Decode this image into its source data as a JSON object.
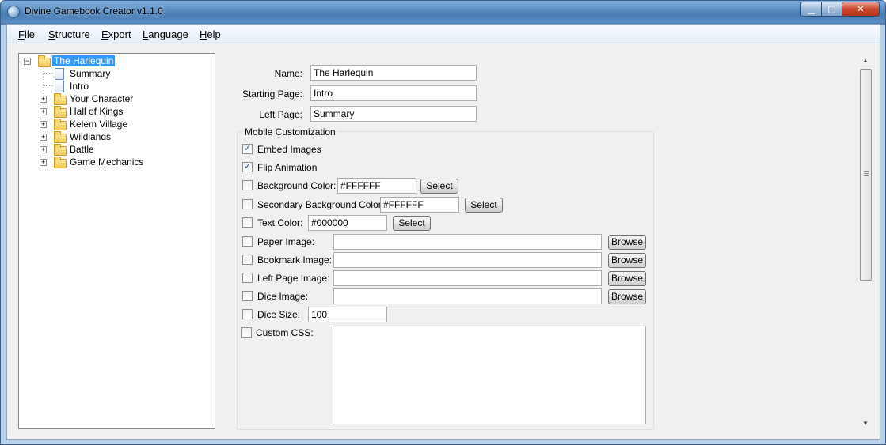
{
  "window": {
    "title": "Divine Gamebook Creator v1.1.0"
  },
  "menu": [
    "File",
    "Structure",
    "Export",
    "Language",
    "Help"
  ],
  "tree": {
    "root": "The Harlequin",
    "pages": [
      "Summary",
      "Intro"
    ],
    "folders": [
      "Your Character",
      "Hall of Kings",
      "Kelem Village",
      "Wildlands",
      "Battle",
      "Game Mechanics"
    ]
  },
  "form": {
    "name_label": "Name:",
    "name_value": "The Harlequin",
    "starting_page_label": "Starting Page:",
    "starting_page_value": "Intro",
    "left_page_label": "Left Page:",
    "left_page_value": "Summary"
  },
  "mobile": {
    "caption": "Mobile Customization",
    "embed_images": {
      "label": "Embed Images",
      "checked": true
    },
    "flip_animation": {
      "label": "Flip Animation",
      "checked": true
    },
    "background_color": {
      "label": "Background Color:",
      "value": "#FFFFFF",
      "button": "Select"
    },
    "secondary_background_color": {
      "label": "Secondary Background Color:",
      "value": "#FFFFFF",
      "button": "Select"
    },
    "text_color": {
      "label": "Text Color:",
      "value": "#000000",
      "button": "Select"
    },
    "paper_image": {
      "label": "Paper Image:",
      "value": "",
      "button": "Browse"
    },
    "bookmark_image": {
      "label": "Bookmark Image:",
      "value": "",
      "button": "Browse"
    },
    "left_page_image": {
      "label": "Left Page Image:",
      "value": "",
      "button": "Browse"
    },
    "dice_image": {
      "label": "Dice Image:",
      "value": "",
      "button": "Browse"
    },
    "dice_size": {
      "label": "Dice Size:",
      "value": "100"
    },
    "custom_css": {
      "label": "Custom CSS:",
      "value": ""
    }
  },
  "icons": {
    "app": "app-globe-icon",
    "minimize": "minimize-icon",
    "maximize": "maximize-icon",
    "close": "close-icon",
    "folder": "folder-icon",
    "page": "page-icon"
  },
  "colors": {
    "selection": "#3399ff",
    "titlebar": "#4a7db4"
  }
}
